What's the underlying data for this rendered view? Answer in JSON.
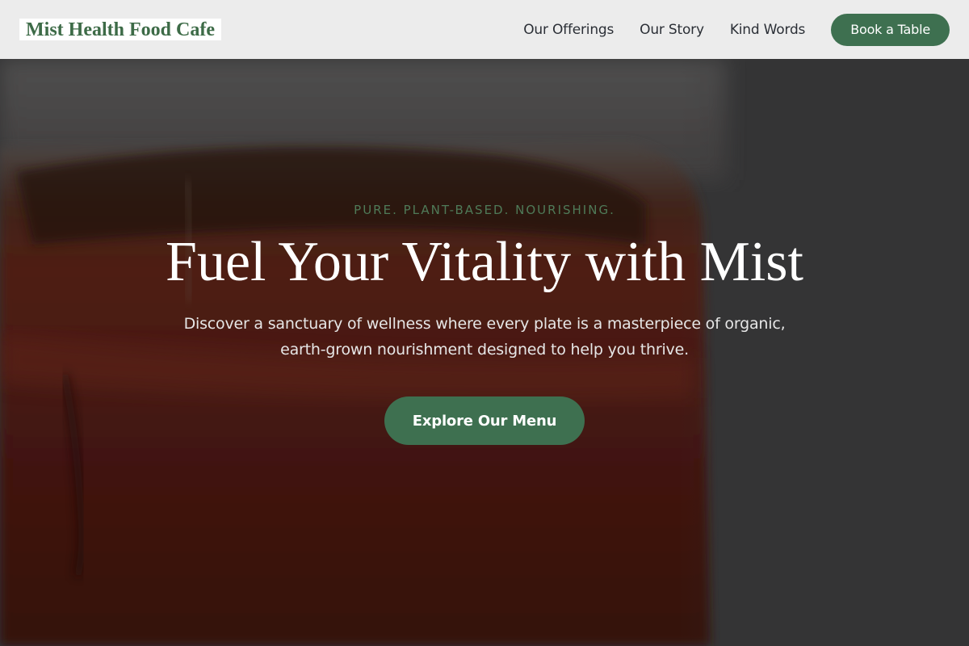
{
  "header": {
    "logo": "Mist Health Food Cafe",
    "nav": [
      {
        "label": "Our Offerings"
      },
      {
        "label": "Our Story"
      },
      {
        "label": "Kind Words"
      }
    ],
    "book_label": "Book a Table"
  },
  "hero": {
    "eyebrow": "PURE. PLANT-BASED. NOURISHING.",
    "headline": "Fuel Your Vitality with Mist",
    "subtext": "Discover a sanctuary of wellness where every plate is a masterpiece of organic, earth-grown nourishment designed to help you thrive.",
    "cta_label": "Explore Our Menu"
  },
  "colors": {
    "brand_green": "#3e7050",
    "nav_bg": "#ececec",
    "hero_overlay": "#3c3c3d"
  }
}
